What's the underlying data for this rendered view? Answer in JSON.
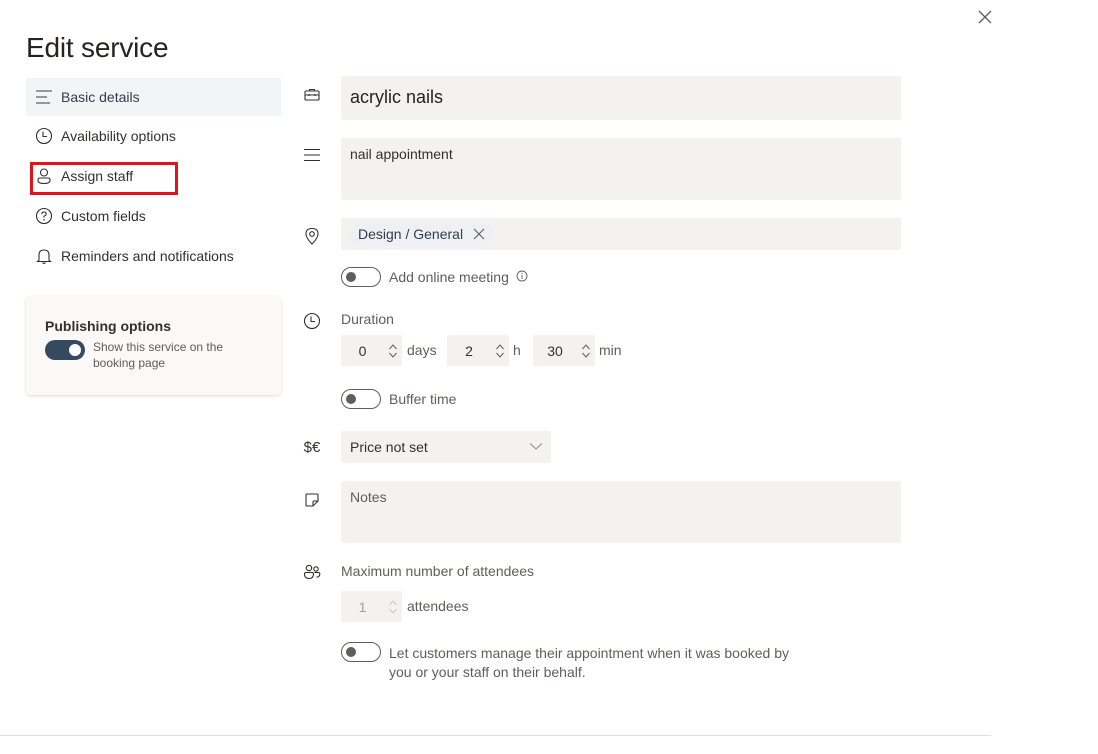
{
  "header": {
    "title": "Edit service",
    "close_icon": "close-icon"
  },
  "nav": {
    "items": [
      {
        "label": "Basic details",
        "icon": "text-align-left-icon",
        "active": true
      },
      {
        "label": "Availability options",
        "icon": "clock-icon",
        "active": false
      },
      {
        "label": "Assign staff",
        "icon": "person-icon",
        "active": false,
        "highlighted": true
      },
      {
        "label": "Custom fields",
        "icon": "question-circle-icon",
        "active": false
      },
      {
        "label": "Reminders and notifications",
        "icon": "bell-icon",
        "active": false
      }
    ],
    "highlight_color": "#e3131c"
  },
  "publishing": {
    "title": "Publishing options",
    "toggle_label": "Show this service on the booking page",
    "toggle_on": true,
    "toggle_color": "#354a5f"
  },
  "form": {
    "service_name": "acrylic nails",
    "description": "nail appointment",
    "location_chip": "Design / General",
    "online_meeting_label": "Add online meeting",
    "online_meeting_on": false,
    "duration": {
      "label": "Duration",
      "days_value": "0",
      "days_unit": "days",
      "hours_value": "2",
      "hours_unit": "h",
      "minutes_value": "30",
      "minutes_unit": "min"
    },
    "buffer_time_label": "Buffer time",
    "buffer_time_on": false,
    "price_select": "Price not set",
    "notes_placeholder": "Notes",
    "max_attendees": {
      "label": "Maximum number of attendees",
      "value": "1",
      "unit": "attendees"
    },
    "customer_manage_label_line1": "Let customers manage their appointment when it was booked by",
    "customer_manage_label_line2": "you or your staff on their behalf.",
    "customer_manage_on": false
  }
}
